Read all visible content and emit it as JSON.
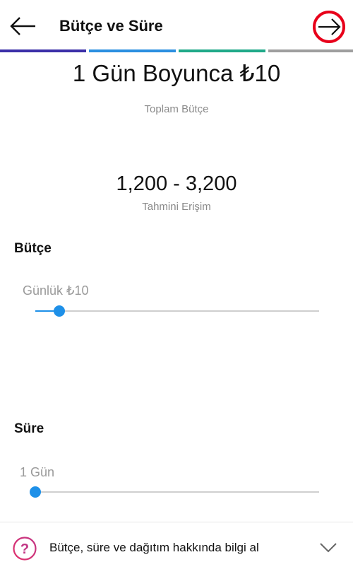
{
  "header": {
    "title": "Bütçe ve Süre",
    "back_icon": "arrow-left-icon",
    "next_icon": "arrow-right-icon",
    "next_highlight_color": "#e8001a"
  },
  "progress": {
    "segments": [
      {
        "color": "#3b2fa8",
        "complete": true
      },
      {
        "color": "#2b8fe0",
        "complete": true
      },
      {
        "color": "#1fa989",
        "complete": true
      },
      {
        "color": "#9e9e9e",
        "complete": false
      }
    ]
  },
  "summary": {
    "headline": "1 Gün Boyunca ₺10",
    "budget_caption": "Toplam Bütçe",
    "reach_value": "1,200 - 3,200",
    "reach_caption": "Tahmini Erişim"
  },
  "budget": {
    "section_title": "Bütçe",
    "slider_label": "Günlük ₺10",
    "slider_value_fraction": 0.085
  },
  "duration": {
    "section_title": "Süre",
    "slider_label": "1 Gün",
    "slider_value_fraction": 0.0
  },
  "footer": {
    "help_text": "Bütçe, süre ve dağıtım hakkında bilgi al",
    "help_icon": "question-circle-icon",
    "chevron_icon": "chevron-down-icon"
  },
  "colors": {
    "accent": "#1e90e8",
    "help_icon_gradient": [
      "#c13584",
      "#e1306c"
    ]
  }
}
